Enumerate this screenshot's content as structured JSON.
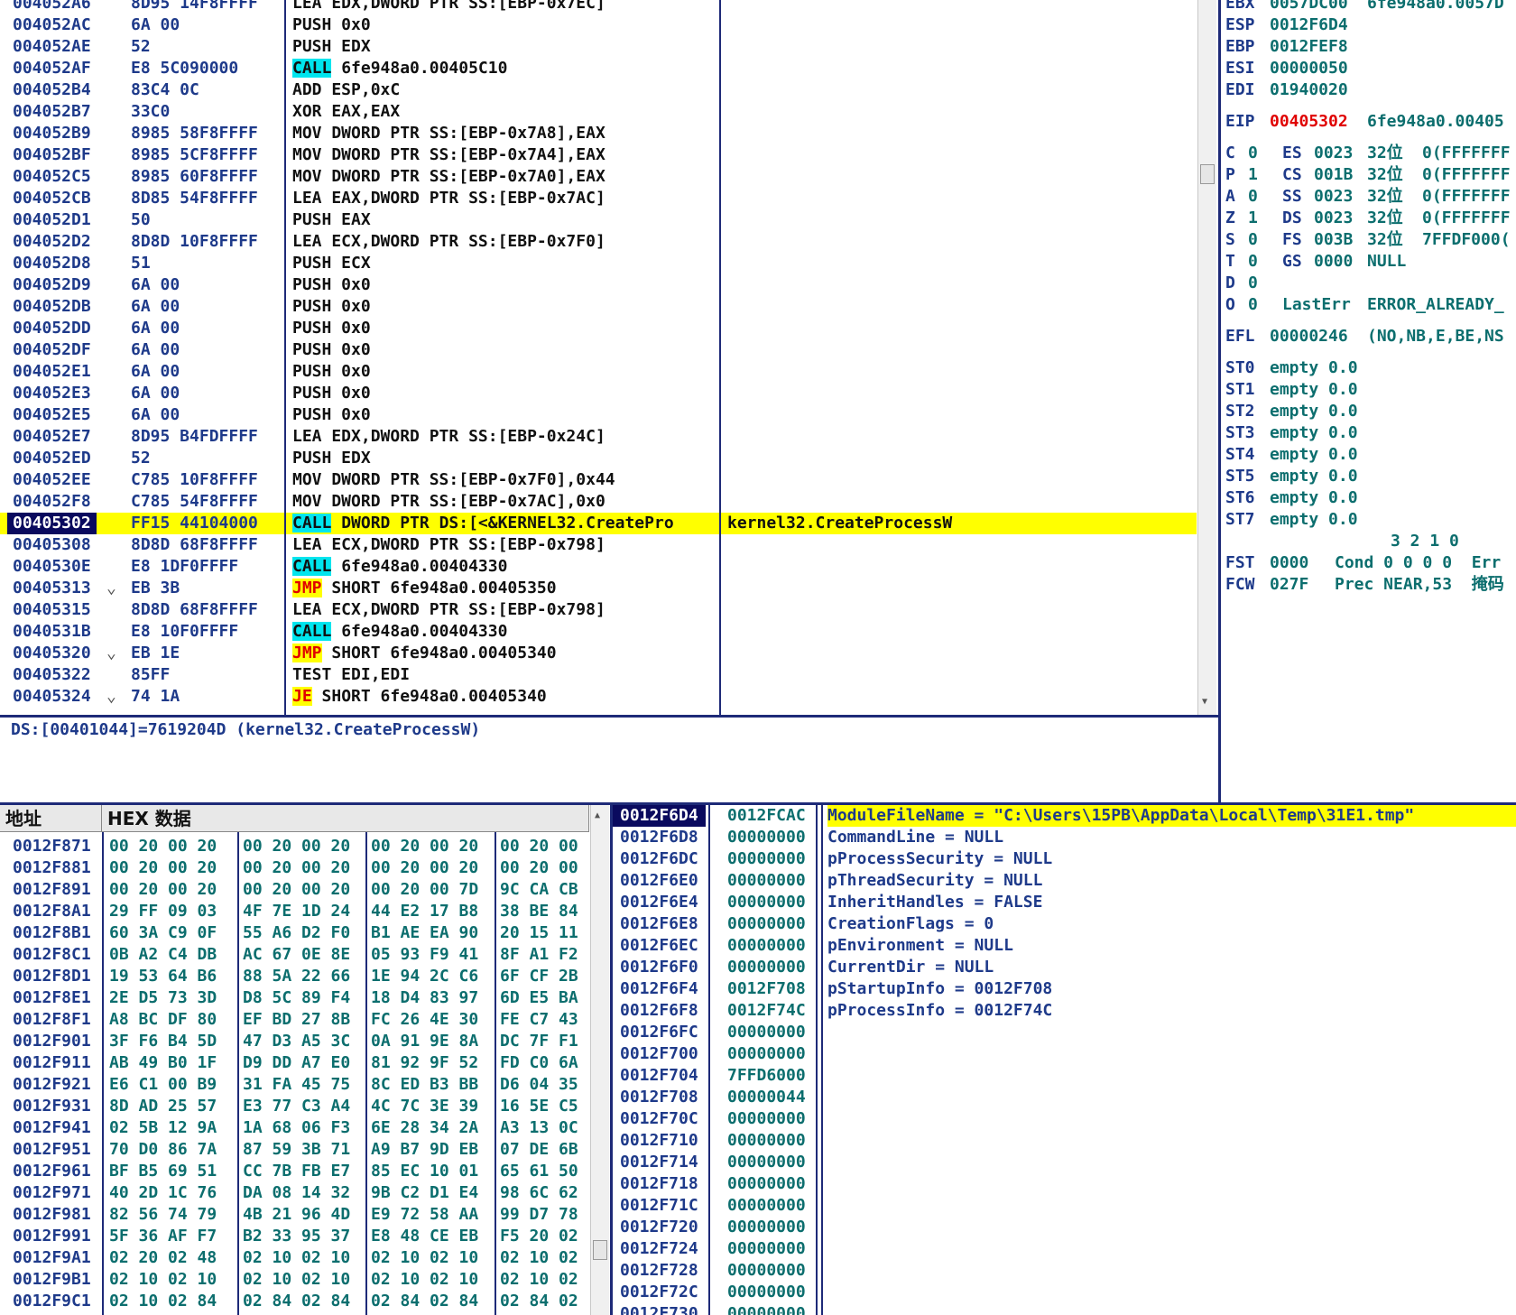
{
  "disasm": {
    "rows": [
      {
        "addr": "004052A6",
        "hex": "8D95 14F8FFFF",
        "asm": "LEA EDX,DWORD PTR SS:[EBP-0x7EC]",
        "cmt": "",
        "jump": ""
      },
      {
        "addr": "004052AC",
        "hex": "6A 00",
        "asm": "PUSH 0x0",
        "cmt": "",
        "jump": ""
      },
      {
        "addr": "004052AE",
        "hex": "52",
        "asm": "PUSH EDX",
        "cmt": "",
        "jump": ""
      },
      {
        "addr": "004052AF",
        "hex": "E8 5C090000",
        "op": "CALL",
        "rest": " 6fe948a0.00405C10",
        "cmt": "",
        "jump": ""
      },
      {
        "addr": "004052B4",
        "hex": "83C4 0C",
        "asm": "ADD ESP,0xC",
        "cmt": "",
        "jump": ""
      },
      {
        "addr": "004052B7",
        "hex": "33C0",
        "asm": "XOR EAX,EAX",
        "cmt": "",
        "jump": ""
      },
      {
        "addr": "004052B9",
        "hex": "8985 58F8FFFF",
        "asm": "MOV DWORD PTR SS:[EBP-0x7A8],EAX",
        "cmt": "",
        "jump": ""
      },
      {
        "addr": "004052BF",
        "hex": "8985 5CF8FFFF",
        "asm": "MOV DWORD PTR SS:[EBP-0x7A4],EAX",
        "cmt": "",
        "jump": ""
      },
      {
        "addr": "004052C5",
        "hex": "8985 60F8FFFF",
        "asm": "MOV DWORD PTR SS:[EBP-0x7A0],EAX",
        "cmt": "",
        "jump": ""
      },
      {
        "addr": "004052CB",
        "hex": "8D85 54F8FFFF",
        "asm": "LEA EAX,DWORD PTR SS:[EBP-0x7AC]",
        "cmt": "",
        "jump": ""
      },
      {
        "addr": "004052D1",
        "hex": "50",
        "asm": "PUSH EAX",
        "cmt": "",
        "jump": ""
      },
      {
        "addr": "004052D2",
        "hex": "8D8D 10F8FFFF",
        "asm": "LEA ECX,DWORD PTR SS:[EBP-0x7F0]",
        "cmt": "",
        "jump": ""
      },
      {
        "addr": "004052D8",
        "hex": "51",
        "asm": "PUSH ECX",
        "cmt": "",
        "jump": ""
      },
      {
        "addr": "004052D9",
        "hex": "6A 00",
        "asm": "PUSH 0x0",
        "cmt": "",
        "jump": ""
      },
      {
        "addr": "004052DB",
        "hex": "6A 00",
        "asm": "PUSH 0x0",
        "cmt": "",
        "jump": ""
      },
      {
        "addr": "004052DD",
        "hex": "6A 00",
        "asm": "PUSH 0x0",
        "cmt": "",
        "jump": ""
      },
      {
        "addr": "004052DF",
        "hex": "6A 00",
        "asm": "PUSH 0x0",
        "cmt": "",
        "jump": ""
      },
      {
        "addr": "004052E1",
        "hex": "6A 00",
        "asm": "PUSH 0x0",
        "cmt": "",
        "jump": ""
      },
      {
        "addr": "004052E3",
        "hex": "6A 00",
        "asm": "PUSH 0x0",
        "cmt": "",
        "jump": ""
      },
      {
        "addr": "004052E5",
        "hex": "6A 00",
        "asm": "PUSH 0x0",
        "cmt": "",
        "jump": ""
      },
      {
        "addr": "004052E7",
        "hex": "8D95 B4FDFFFF",
        "asm": "LEA EDX,DWORD PTR SS:[EBP-0x24C]",
        "cmt": "",
        "jump": ""
      },
      {
        "addr": "004052ED",
        "hex": "52",
        "asm": "PUSH EDX",
        "cmt": "",
        "jump": ""
      },
      {
        "addr": "004052EE",
        "hex": "C785 10F8FFFF",
        "asm": "MOV DWORD PTR SS:[EBP-0x7F0],0x44",
        "cmt": "",
        "jump": ""
      },
      {
        "addr": "004052F8",
        "hex": "C785 54F8FFFF",
        "asm": "MOV DWORD PTR SS:[EBP-0x7AC],0x0",
        "cmt": "",
        "jump": ""
      },
      {
        "addr": "00405302",
        "hex": "FF15 44104000",
        "op": "CALL",
        "rest": " DWORD PTR DS:[<&KERNEL32.CreatePro",
        "cmt": "kernel32.CreateProcessW",
        "jump": "",
        "current": true
      },
      {
        "addr": "00405308",
        "hex": "8D8D 68F8FFFF",
        "asm": "LEA ECX,DWORD PTR SS:[EBP-0x798]",
        "cmt": "",
        "jump": ""
      },
      {
        "addr": "0040530E",
        "hex": "E8 1DF0FFFF",
        "op": "CALL",
        "rest": " 6fe948a0.00404330",
        "cmt": "",
        "jump": ""
      },
      {
        "addr": "00405313",
        "hex": "EB 3B",
        "op": "JMP",
        "rest": " SHORT 6fe948a0.00405350",
        "cmt": "",
        "jump": "⌄"
      },
      {
        "addr": "00405315",
        "hex": "8D8D 68F8FFFF",
        "asm": "LEA ECX,DWORD PTR SS:[EBP-0x798]",
        "cmt": "",
        "jump": ""
      },
      {
        "addr": "0040531B",
        "hex": "E8 10F0FFFF",
        "op": "CALL",
        "rest": " 6fe948a0.00404330",
        "cmt": "",
        "jump": ""
      },
      {
        "addr": "00405320",
        "hex": "EB 1E",
        "op": "JMP",
        "rest": " SHORT 6fe948a0.00405340",
        "cmt": "",
        "jump": "⌄"
      },
      {
        "addr": "00405322",
        "hex": "85FF",
        "asm": "TEST EDI,EDI",
        "cmt": "",
        "jump": ""
      },
      {
        "addr": "00405324",
        "hex": "74 1A",
        "op": "JE",
        "rest": " SHORT 6fe948a0.00405340",
        "cmt": "",
        "jump": "⌄"
      }
    ]
  },
  "info_line": "DS:[00401044]=7619204D (kernel32.CreateProcessW)",
  "registers": {
    "top": [
      {
        "name": "EBX",
        "value": "0057DC00",
        "extra": "6fe948a0.0057D"
      },
      {
        "name": "ESP",
        "value": "0012F6D4",
        "extra": ""
      },
      {
        "name": "EBP",
        "value": "0012FEF8",
        "extra": ""
      },
      {
        "name": "ESI",
        "value": "00000050",
        "extra": ""
      },
      {
        "name": "EDI",
        "value": "01940020",
        "extra": ""
      }
    ],
    "eip": {
      "name": "EIP",
      "value": "00405302",
      "extra": "6fe948a0.00405"
    },
    "flags": [
      {
        "f": "C",
        "v": "0",
        "seg": "ES",
        "sv": "0023",
        "bits": "32位",
        "base": "0(FFFFFFF"
      },
      {
        "f": "P",
        "v": "1",
        "seg": "CS",
        "sv": "001B",
        "bits": "32位",
        "base": "0(FFFFFFF"
      },
      {
        "f": "A",
        "v": "0",
        "seg": "SS",
        "sv": "0023",
        "bits": "32位",
        "base": "0(FFFFFFF"
      },
      {
        "f": "Z",
        "v": "1",
        "seg": "DS",
        "sv": "0023",
        "bits": "32位",
        "base": "0(FFFFFFF"
      },
      {
        "f": "S",
        "v": "0",
        "seg": "FS",
        "sv": "003B",
        "bits": "32位",
        "base": "7FFDF000("
      },
      {
        "f": "T",
        "v": "0",
        "seg": "GS",
        "sv": "0000",
        "bits": "NULL",
        "base": ""
      },
      {
        "f": "D",
        "v": "0",
        "seg": "",
        "sv": "",
        "bits": "",
        "base": ""
      },
      {
        "f": "O",
        "v": "0",
        "seg": "",
        "sv": "LastErr",
        "bits": "ERROR_ALREADY_",
        "base": ""
      }
    ],
    "efl": {
      "name": "EFL",
      "value": "00000246",
      "extra": "(NO,NB,E,BE,NS"
    },
    "fpu": [
      {
        "name": "ST0",
        "value": "empty 0.0"
      },
      {
        "name": "ST1",
        "value": "empty 0.0"
      },
      {
        "name": "ST2",
        "value": "empty 0.0"
      },
      {
        "name": "ST3",
        "value": "empty 0.0"
      },
      {
        "name": "ST4",
        "value": "empty 0.0"
      },
      {
        "name": "ST5",
        "value": "empty 0.0"
      },
      {
        "name": "ST6",
        "value": "empty 0.0"
      },
      {
        "name": "ST7",
        "value": "empty 0.0"
      }
    ],
    "cond_header": "3 2 1 0",
    "fst": {
      "name": "FST",
      "value": "0000",
      "extra": "Cond 0 0 0 0  Err"
    },
    "fcw": {
      "name": "FCW",
      "value": "027F",
      "extra": "Prec NEAR,53  掩码"
    }
  },
  "dump": {
    "col_addr": "地址",
    "col_hex": "HEX 数据",
    "rows": [
      {
        "addr": "0012F871",
        "b": [
          "00 20 00 20",
          "00 20 00 20",
          "00 20 00 20",
          "00 20 00"
        ]
      },
      {
        "addr": "0012F881",
        "b": [
          "00 20 00 20",
          "00 20 00 20",
          "00 20 00 20",
          "00 20 00"
        ]
      },
      {
        "addr": "0012F891",
        "b": [
          "00 20 00 20",
          "00 20 00 20",
          "00 20 00 7D",
          "9C CA CB"
        ]
      },
      {
        "addr": "0012F8A1",
        "b": [
          "29 FF 09 03",
          "4F 7E 1D 24",
          "44 E2 17 B8",
          "38 BE 84"
        ]
      },
      {
        "addr": "0012F8B1",
        "b": [
          "60 3A C9 0F",
          "55 A6 D2 F0",
          "B1 AE EA 90",
          "20 15 11"
        ]
      },
      {
        "addr": "0012F8C1",
        "b": [
          "0B A2 C4 DB",
          "AC 67 0E 8E",
          "05 93 F9 41",
          "8F A1 F2"
        ]
      },
      {
        "addr": "0012F8D1",
        "b": [
          "19 53 64 B6",
          "88 5A 22 66",
          "1E 94 2C C6",
          "6F CF 2B"
        ]
      },
      {
        "addr": "0012F8E1",
        "b": [
          "2E D5 73 3D",
          "D8 5C 89 F4",
          "18 D4 83 97",
          "6D E5 BA"
        ]
      },
      {
        "addr": "0012F8F1",
        "b": [
          "A8 BC DF 80",
          "EF BD 27 8B",
          "FC 26 4E 30",
          "FE C7 43"
        ]
      },
      {
        "addr": "0012F901",
        "b": [
          "3F F6 B4 5D",
          "47 D3 A5 3C",
          "0A 91 9E 8A",
          "DC 7F F1"
        ]
      },
      {
        "addr": "0012F911",
        "b": [
          "AB 49 B0 1F",
          "D9 DD A7 E0",
          "81 92 9F 52",
          "FD C0 6A"
        ]
      },
      {
        "addr": "0012F921",
        "b": [
          "E6 C1 00 B9",
          "31 FA 45 75",
          "8C ED B3 BB",
          "D6 04 35"
        ]
      },
      {
        "addr": "0012F931",
        "b": [
          "8D AD 25 57",
          "E3 77 C3 A4",
          "4C 7C 3E 39",
          "16 5E C5"
        ]
      },
      {
        "addr": "0012F941",
        "b": [
          "02 5B 12 9A",
          "1A 68 06 F3",
          "6E 28 34 2A",
          "A3 13 0C"
        ]
      },
      {
        "addr": "0012F951",
        "b": [
          "70 D0 86 7A",
          "87 59 3B 71",
          "A9 B7 9D EB",
          "07 DE 6B"
        ]
      },
      {
        "addr": "0012F961",
        "b": [
          "BF B5 69 51",
          "CC 7B FB E7",
          "85 EC 10 01",
          "65 61 50"
        ]
      },
      {
        "addr": "0012F971",
        "b": [
          "40 2D 1C 76",
          "DA 08 14 32",
          "9B C2 D1 E4",
          "98 6C 62"
        ]
      },
      {
        "addr": "0012F981",
        "b": [
          "82 56 74 79",
          "4B 21 96 4D",
          "E9 72 58 AA",
          "99 D7 78"
        ]
      },
      {
        "addr": "0012F991",
        "b": [
          "5F 36 AF F7",
          "B2 33 95 37",
          "E8 48 CE EB",
          "F5 20 02"
        ]
      },
      {
        "addr": "0012F9A1",
        "b": [
          "02 20 02 48",
          "02 10 02 10",
          "02 10 02 10",
          "02 10 02"
        ]
      },
      {
        "addr": "0012F9B1",
        "b": [
          "02 10 02 10",
          "02 10 02 10",
          "02 10 02 10",
          "02 10 02"
        ]
      },
      {
        "addr": "0012F9C1",
        "b": [
          "02 10 02 84",
          "02 84 02 84",
          "02 84 02 84",
          "02 84 02"
        ]
      }
    ]
  },
  "stack": {
    "rows": [
      {
        "addr": "0012F6D4",
        "val": "0012FCAC",
        "cmt": "ModuleFileName = \"C:\\Users\\15PB\\AppData\\Local\\Temp\\31E1.tmp\"",
        "sel": true
      },
      {
        "addr": "0012F6D8",
        "val": "00000000",
        "cmt": "CommandLine = NULL"
      },
      {
        "addr": "0012F6DC",
        "val": "00000000",
        "cmt": "pProcessSecurity = NULL"
      },
      {
        "addr": "0012F6E0",
        "val": "00000000",
        "cmt": "pThreadSecurity = NULL"
      },
      {
        "addr": "0012F6E4",
        "val": "00000000",
        "cmt": "InheritHandles = FALSE"
      },
      {
        "addr": "0012F6E8",
        "val": "00000000",
        "cmt": "CreationFlags = 0"
      },
      {
        "addr": "0012F6EC",
        "val": "00000000",
        "cmt": "pEnvironment = NULL"
      },
      {
        "addr": "0012F6F0",
        "val": "00000000",
        "cmt": "CurrentDir = NULL"
      },
      {
        "addr": "0012F6F4",
        "val": "0012F708",
        "cmt": "pStartupInfo = 0012F708"
      },
      {
        "addr": "0012F6F8",
        "val": "0012F74C",
        "cmt": "pProcessInfo = 0012F74C"
      },
      {
        "addr": "0012F6FC",
        "val": "00000000",
        "cmt": ""
      },
      {
        "addr": "0012F700",
        "val": "00000000",
        "cmt": ""
      },
      {
        "addr": "0012F704",
        "val": "7FFD6000",
        "cmt": ""
      },
      {
        "addr": "0012F708",
        "val": "00000044",
        "cmt": ""
      },
      {
        "addr": "0012F70C",
        "val": "00000000",
        "cmt": ""
      },
      {
        "addr": "0012F710",
        "val": "00000000",
        "cmt": ""
      },
      {
        "addr": "0012F714",
        "val": "00000000",
        "cmt": ""
      },
      {
        "addr": "0012F718",
        "val": "00000000",
        "cmt": ""
      },
      {
        "addr": "0012F71C",
        "val": "00000000",
        "cmt": ""
      },
      {
        "addr": "0012F720",
        "val": "00000000",
        "cmt": ""
      },
      {
        "addr": "0012F724",
        "val": "00000000",
        "cmt": ""
      },
      {
        "addr": "0012F728",
        "val": "00000000",
        "cmt": ""
      },
      {
        "addr": "0012F72C",
        "val": "00000000",
        "cmt": ""
      },
      {
        "addr": "0012F730",
        "val": "00000000",
        "cmt": ""
      }
    ]
  }
}
